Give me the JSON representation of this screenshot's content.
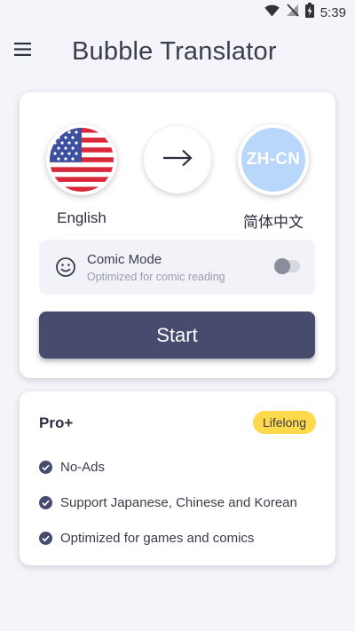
{
  "status_bar": {
    "time": "5:39",
    "icons": [
      "wifi-icon",
      "no-signal-icon",
      "battery-charging-icon"
    ]
  },
  "app_bar": {
    "menu_icon": "hamburger-menu-icon",
    "title": "Bubble Translator"
  },
  "translator": {
    "source": {
      "label": "English",
      "icon": "us-flag-icon"
    },
    "swap_icon": "arrow-right-icon",
    "target": {
      "code": "ZH-CN",
      "label": "简体中文"
    },
    "comic_mode": {
      "icon": "smiley-icon",
      "title": "Comic Mode",
      "subtitle": "Optimized for comic reading",
      "enabled": false
    },
    "start_label": "Start"
  },
  "pro": {
    "title": "Pro+",
    "badge": "Lifelong",
    "features": [
      "No-Ads",
      "Support Japanese, Chinese and Korean",
      "Optimized for games and comics"
    ]
  },
  "colors": {
    "background": "#f4f5fa",
    "start_button": "#474c6e",
    "badge": "#fdd94b",
    "zh_circle": "#b9d7fb",
    "check": "#474c6e"
  }
}
